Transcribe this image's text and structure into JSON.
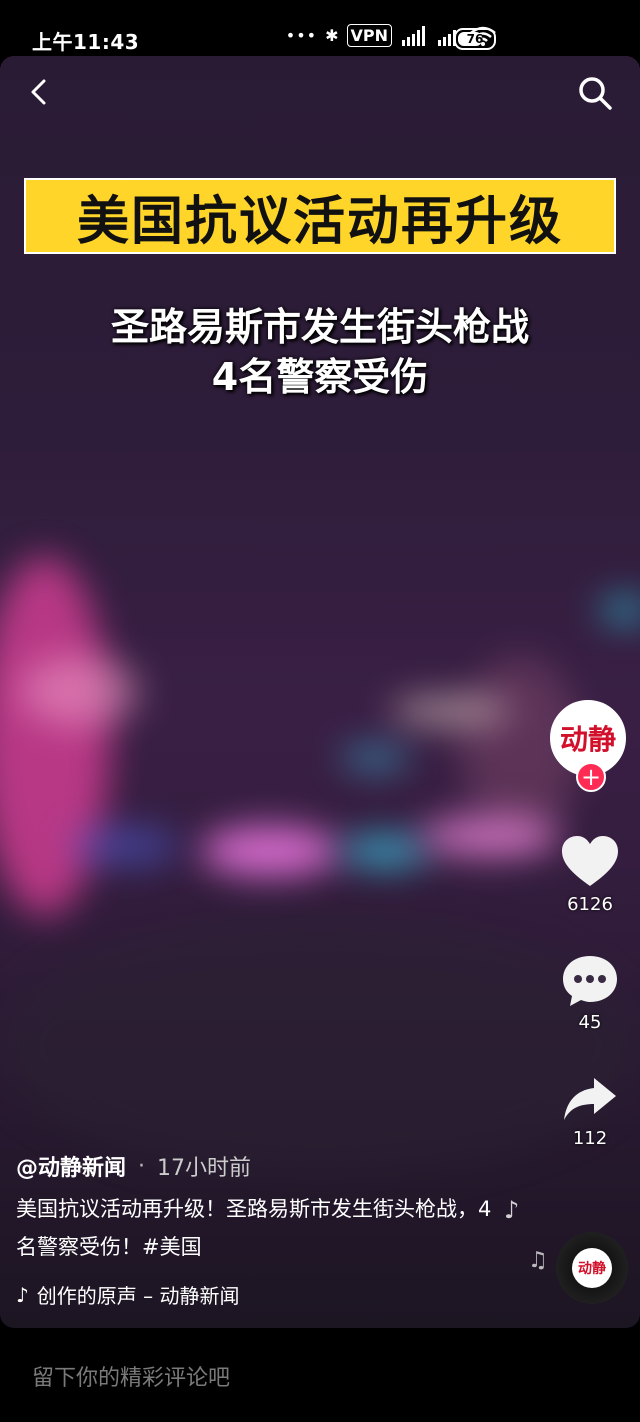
{
  "status_bar": {
    "time": "上午11:43",
    "dots": "•••",
    "vpn": "VPN",
    "signal": "HD",
    "battery": "76"
  },
  "video": {
    "banner_title": "美国抗议活动再升级",
    "subtitle_line1": "圣路易斯市发生街头枪战",
    "subtitle_line2": "4名警察受伤"
  },
  "sidebar": {
    "avatar_text": "动静",
    "follow_label": "+",
    "likes": "6126",
    "comments": "45",
    "shares": "112"
  },
  "info": {
    "author": "@动静新闻",
    "separator": "·",
    "time_ago": "17小时前",
    "caption": "美国抗议活动再升级！圣路易斯市发生街头枪战，4名警察受伤！#美国",
    "music": "创作的原声 – 动静新闻",
    "disc_text": "动静"
  },
  "comment_bar": {
    "placeholder": "留下你的精彩评论吧"
  },
  "icons": [
    "back-icon",
    "search-icon",
    "heart-icon",
    "comment-icon",
    "share-icon",
    "music-note-icon",
    "music-disc-icon"
  ],
  "colors": {
    "banner": "#ffd529",
    "follow": "#fe2c55",
    "brand_red": "#d3102b"
  }
}
